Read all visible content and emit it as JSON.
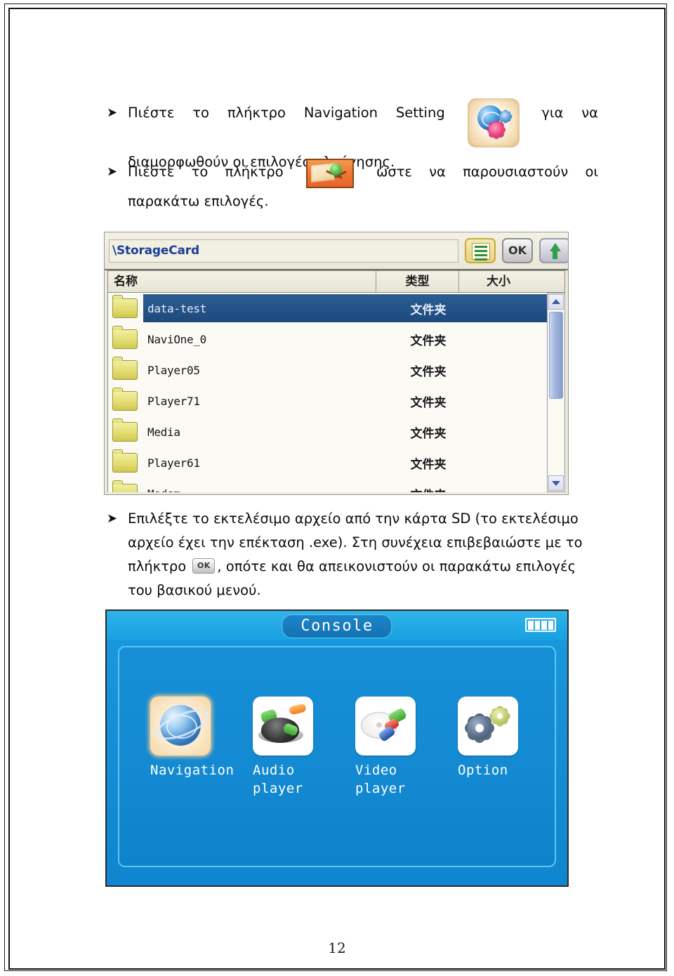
{
  "document": {
    "page_number": "12",
    "language": "el"
  },
  "bullets": [
    {
      "marker": "➤",
      "line1_pre": "Πιέστε",
      "line1_words": [
        "Πιέστε",
        "το",
        "πλήκτρο",
        "Navigation",
        "Setting"
      ],
      "icon": "navigation-setting-icon",
      "line1_post_words": [
        "για",
        "να"
      ],
      "line2": "διαμορφωθούν οι επιλογές πλοήγησης."
    },
    {
      "marker": "➤",
      "line1_words": [
        "Πιέστε",
        "το",
        "πλήκτρο"
      ],
      "icon": "map-navigation-icon",
      "line1_post_words": [
        "ώστε",
        "να",
        "παρουσιαστούν",
        "οι"
      ],
      "line2": "παρακάτω επιλογές."
    },
    {
      "marker": "➤",
      "line1": "Επιλέξτε το εκτελέσιμο αρχείο από την κάρτα SD (το εκτελέσιμο",
      "line2": "αρχείο έχει την επέκταση .exe). Στη συνέχεια επιβεβαιώστε με το",
      "line3_pre": "πλήκτρο",
      "icon": "ok-key-icon",
      "icon_label": "OK",
      "line3_post": ", οπότε και θα απεικονιστούν οι παρακάτω επιλογές",
      "line4": "του βασικού μενού."
    }
  ],
  "file_manager": {
    "path_value": "\\StorageCard",
    "toolbar": {
      "list_button": "list-view-icon",
      "ok_button": "OK",
      "up_button": "up-arrow-icon"
    },
    "columns": [
      "名称",
      "类型",
      "大小"
    ],
    "rows": [
      {
        "name": "data-test",
        "type": "文件夹",
        "size": "",
        "selected": true
      },
      {
        "name": "NaviOne_0",
        "type": "文件夹",
        "size": "",
        "selected": false
      },
      {
        "name": "Player05",
        "type": "文件夹",
        "size": "",
        "selected": false
      },
      {
        "name": "Player71",
        "type": "文件夹",
        "size": "",
        "selected": false
      },
      {
        "name": "Media",
        "type": "文件夹",
        "size": "",
        "selected": false
      },
      {
        "name": "Player61",
        "type": "文件夹",
        "size": "",
        "selected": false
      },
      {
        "name": "Modem",
        "type": "文件夹",
        "size": "",
        "selected": false
      }
    ]
  },
  "console": {
    "title": "Console",
    "battery": "battery-icon",
    "menu": [
      {
        "label": "Navigation",
        "icon": "globe-navigation-icon",
        "active": true
      },
      {
        "label": "Audio\nplayer",
        "icon": "audio-player-icon",
        "active": false
      },
      {
        "label": "Video\nplayer",
        "icon": "video-player-icon",
        "active": false
      },
      {
        "label": "Option",
        "icon": "option-gears-icon",
        "active": false
      }
    ]
  },
  "colors": {
    "console_blue": "#128ad3",
    "selection_blue": "#23538a",
    "folder_yellow": "#e3dd72",
    "path_text_blue": "#1c3f96"
  }
}
